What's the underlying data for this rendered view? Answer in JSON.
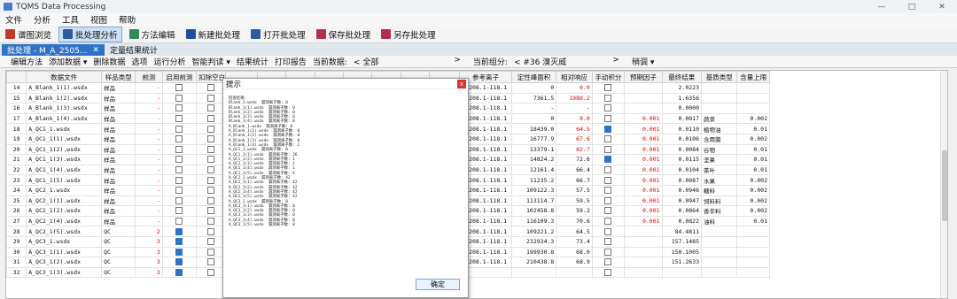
{
  "window": {
    "title": "TQMS Data Processing",
    "controls": [
      "—",
      "□",
      "✕"
    ]
  },
  "menu": [
    "文件",
    "分析",
    "工具",
    "视图",
    "帮助"
  ],
  "toolbar": [
    {
      "label": "谱图浏览",
      "icon": "spectrum-icon",
      "color": "#c0392b",
      "active": false
    },
    {
      "label": "批处理分析",
      "icon": "batch-icon",
      "color": "#2c5aa0",
      "active": true
    },
    {
      "label": "方法编辑",
      "icon": "method-icon",
      "color": "#2e8b57",
      "active": false
    },
    {
      "label": "新建批处理",
      "icon": "new-batch-icon",
      "color": "#1f4f9c",
      "active": false
    },
    {
      "label": "打开批处理",
      "icon": "folder-icon",
      "color": "#2c5aa0",
      "active": false
    },
    {
      "label": "保存批处理",
      "icon": "save-icon",
      "color": "#b03050",
      "active": false
    },
    {
      "label": "另存批处理",
      "icon": "save-as-icon",
      "color": "#b03050",
      "active": false
    }
  ],
  "tabs": [
    {
      "label": "批处理 - M_A_2505...",
      "active": true,
      "close": "✕"
    },
    {
      "label": "定量结果统计",
      "active": false
    }
  ],
  "subbar": {
    "items": [
      "编辑方法",
      "添加数据 ▾",
      "删除数据",
      "选项",
      "运行分析",
      "智能判读 ▾",
      "结果统计",
      "打印报告"
    ],
    "current_data_label": "当前数据:",
    "current_data_value": "<  全部",
    "current_data_arrow": ">",
    "current_group_label": "当前组分:",
    "current_group_value": "<  #36    溴灭威",
    "current_group_arrow": ">",
    "group_extra": "稍调 ▾"
  },
  "columns": [
    "",
    "数据文件",
    "样品类型",
    "前测",
    "启用前测",
    "扣除空白",
    "",
    "",
    "",
    "",
    "",
    "",
    "",
    "",
    "参考离子",
    "定性峰面积",
    "相对响应",
    "手动积分",
    "预期因子",
    "最终结果",
    "基质类型",
    "含量上限"
  ],
  "rows": [
    {
      "no": "14",
      "file": "A_Blank_1(1).wsdx",
      "type": "样品",
      "pre": "-",
      "en": false,
      "ded": false,
      "ref": "3 208.1-118.1",
      "area": "0",
      "rr": "0.0",
      "rrRed": true,
      "man": false,
      "exp": "",
      "final": "2.0223",
      "matrix": "",
      "limit": ""
    },
    {
      "no": "15",
      "file": "A_Blank_1(2).wsdx",
      "type": "样品",
      "pre": "-",
      "en": false,
      "ded": false,
      "ref": "8 208.1-118.1",
      "area": "7361.5",
      "rr": "1988.2",
      "rrRed": true,
      "man": false,
      "exp": "",
      "final": "1.6356",
      "matrix": "",
      "limit": ""
    },
    {
      "no": "16",
      "file": "A_Blank_1(3).wsdx",
      "type": "样品",
      "pre": "-",
      "en": false,
      "ded": false,
      "ref": "1 208.1-118.1",
      "area": "-",
      "rr": "-",
      "rrRed": false,
      "man": false,
      "exp": "",
      "final": "0.0000",
      "matrix": "",
      "limit": ""
    },
    {
      "no": "17",
      "file": "A_Blank_1(4).wsdx",
      "type": "样品",
      "pre": "-",
      "en": false,
      "ded": false,
      "ref": "9 208.1-118.1",
      "area": "0",
      "rr": "0.0",
      "rrRed": true,
      "man": false,
      "exp": "0.001",
      "final": "0.0017",
      "matrix": "蔬菜",
      "limit": "0.002"
    },
    {
      "no": "18",
      "file": "A_QC1_1.wsdx",
      "type": "样品",
      "pre": "-",
      "en": false,
      "ded": false,
      "ref": "0 208.1-118.1",
      "area": "18439.0",
      "rr": "64.5",
      "rrRed": true,
      "man": true,
      "exp": "0.001",
      "final": "0.0110",
      "matrix": "植物油",
      "limit": "0.01"
    },
    {
      "no": "19",
      "file": "A_QC1_1(1).wsdx",
      "type": "样品",
      "pre": "-",
      "en": false,
      "ded": false,
      "ref": "6 208.1-118.1",
      "area": "16777.9",
      "rr": "67.6",
      "rrRed": true,
      "man": false,
      "exp": "0.001",
      "final": "0.0106",
      "matrix": "含用菌",
      "limit": "0.002"
    },
    {
      "no": "20",
      "file": "A_QC1_1(2).wsdx",
      "type": "样品",
      "pre": "-",
      "en": false,
      "ded": false,
      "ref": "6 208.1-118.1",
      "area": "13379.1",
      "rr": "82.7",
      "rrRed": true,
      "man": false,
      "exp": "0.001",
      "final": "0.0084",
      "matrix": "谷物",
      "limit": "0.01"
    },
    {
      "no": "21",
      "file": "A_QC1_1(3).wsdx",
      "type": "样品",
      "pre": "-",
      "en": false,
      "ded": false,
      "ref": "1 208.1-118.1",
      "area": "14824.2",
      "rr": "72.6",
      "rrRed": false,
      "man": true,
      "exp": "0.001",
      "final": "0.0115",
      "matrix": "坚果",
      "limit": "0.01"
    },
    {
      "no": "22",
      "file": "A_QC1_1(4).wsdx",
      "type": "样品",
      "pre": "-",
      "en": false,
      "ded": false,
      "ref": "3 208.1-118.1",
      "area": "12161.4",
      "rr": "66.4",
      "rrRed": false,
      "man": false,
      "exp": "0.001",
      "final": "0.0104",
      "matrix": "茶叶",
      "limit": "0.01"
    },
    {
      "no": "23",
      "file": "A_QC1_1(5).wsdx",
      "type": "样品",
      "pre": "-",
      "en": false,
      "ded": false,
      "ref": "1 208.1-118.1",
      "area": "11235.2",
      "rr": "66.7",
      "rrRed": false,
      "man": false,
      "exp": "0.001",
      "final": "0.0087",
      "matrix": "水果",
      "limit": "0.002"
    },
    {
      "no": "24",
      "file": "A_QC2_1.wsdx",
      "type": "样品",
      "pre": "-",
      "en": false,
      "ded": false,
      "ref": "9 208.1-118.1",
      "area": "109122.3",
      "rr": "57.5",
      "rrRed": false,
      "man": false,
      "exp": "0.001",
      "final": "0.0946",
      "matrix": "糖料",
      "limit": "0.002"
    },
    {
      "no": "25",
      "file": "A_QC2_1(1).wsdx",
      "type": "样品",
      "pre": "-",
      "en": false,
      "ded": false,
      "ref": "0 208.1-118.1",
      "area": "113114.7",
      "rr": "59.5",
      "rrRed": false,
      "man": false,
      "exp": "0.001",
      "final": "0.0947",
      "matrix": "饲料料",
      "limit": "0.002"
    },
    {
      "no": "26",
      "file": "A_QC2_1(2).wsdx",
      "type": "样品",
      "pre": "-",
      "en": false,
      "ded": false,
      "ref": "0 208.1-118.1",
      "area": "102458.8",
      "rr": "59.2",
      "rrRed": false,
      "man": false,
      "exp": "0.001",
      "final": "0.0864",
      "matrix": "香辛料",
      "limit": "0.002"
    },
    {
      "no": "27",
      "file": "A_QC2_1(4).wsdx",
      "type": "样品",
      "pre": "-",
      "en": false,
      "ded": false,
      "ref": "1 208.1-118.1",
      "area": "116109.3",
      "rr": "70.6",
      "rrRed": false,
      "man": false,
      "exp": "0.001",
      "final": "0.0822",
      "matrix": "油料",
      "limit": "0.01"
    },
    {
      "no": "28",
      "file": "A_QC2_1(5).wsdx",
      "type": "QC",
      "pre": "2",
      "en": true,
      "ded": false,
      "ref": "3 208.1-118.1",
      "area": "109221.2",
      "rr": "64.5",
      "rrRed": false,
      "man": false,
      "exp": "",
      "final": "84.4811",
      "matrix": "",
      "limit": ""
    },
    {
      "no": "29",
      "file": "A_QC3_1.wsdx",
      "type": "QC",
      "pre": "3",
      "en": true,
      "ded": false,
      "ref": "1 208.1-118.1",
      "area": "232934.3",
      "rr": "73.4",
      "rrRed": false,
      "man": false,
      "exp": "",
      "final": "157.1485",
      "matrix": "",
      "limit": ""
    },
    {
      "no": "30",
      "file": "A_QC3_1(1).wsdx",
      "type": "QC",
      "pre": "3",
      "en": true,
      "ded": false,
      "ref": "9 208.1-118.1",
      "area": "199930.8",
      "rr": "68.0",
      "rrRed": false,
      "man": false,
      "exp": "",
      "final": "150.1005",
      "matrix": "",
      "limit": ""
    },
    {
      "no": "31",
      "file": "A_QC3_1(2).wsdx",
      "type": "QC",
      "pre": "3",
      "en": true,
      "ded": false,
      "ref": "6 208.1-118.1",
      "area": "210438.8",
      "rr": "68.9",
      "rrRed": false,
      "man": false,
      "exp": "",
      "final": "151.2633",
      "matrix": "",
      "limit": ""
    },
    {
      "no": "32",
      "file": "A_QC3_1(3).wsdx",
      "type": "QC",
      "pre": "3",
      "en": true,
      "ded": false,
      "ref": "",
      "area": "",
      "rr": "",
      "rrRed": false,
      "man": false,
      "exp": "",
      "final": "",
      "matrix": "",
      "limit": ""
    }
  ],
  "dialog": {
    "title": "提示",
    "close": "x",
    "body": "检查结果:\nBlank_1.wsdx  漏测离子数: 0\nBlank_1(1).wsdx  漏测离子数: 0\nBlank_1(2).wsdx  漏测离子数: 0\nBlank_1(3).wsdx  漏测离子数: 0\nBlank_1(4).wsdx  漏测离子数: 0\nA_Blank_1.wsdx  漏测离子数: 0\nA_Blank_1(1).wsdx  漏测离子数: 0\nA_Blank_1(2).wsdx  漏测离子数: 0\nA_Blank_1(3).wsdx  漏测离子数: 0\nA_Blank_1(4).wsdx  漏测离子数: 1\nA_QC1_1.wsdx  漏测离子数: 0\nA_QC1_1(1).wsdx  漏测离子数: 26\nA_QC1_1(2).wsdx  漏测离子数: 1\nA_QC1_1(3).wsdx  漏测离子数: 2\nA_QC1_1(4).wsdx  漏测离子数: 1\nA_QC1_1(5).wsdx  漏测离子数: 4\nA_QC2_1.wsdx  漏测离子数: 42\nA_QC2_1(1).wsdx  漏测离子数: 42\nA_QC2_1(2).wsdx  漏测离子数: 42\nA_QC2_1(4).wsdx  漏测离子数: 42\nA_QC2_1(5).wsdx  漏测离子数: 42\nA_QC3_1.wsdx  漏测离子数: 0\nA_QC3_1(1).wsdx  漏测离子数: 0\nA_QC3_1(2).wsdx  漏测离子数: 0\nA_QC3_1(3).wsdx  漏测离子数: 0\nA_QC3_1(4).wsdx  漏测离子数: 0\nA_QC3_1(5).wsdx  漏测离子数: 0",
    "ok": "确定"
  }
}
